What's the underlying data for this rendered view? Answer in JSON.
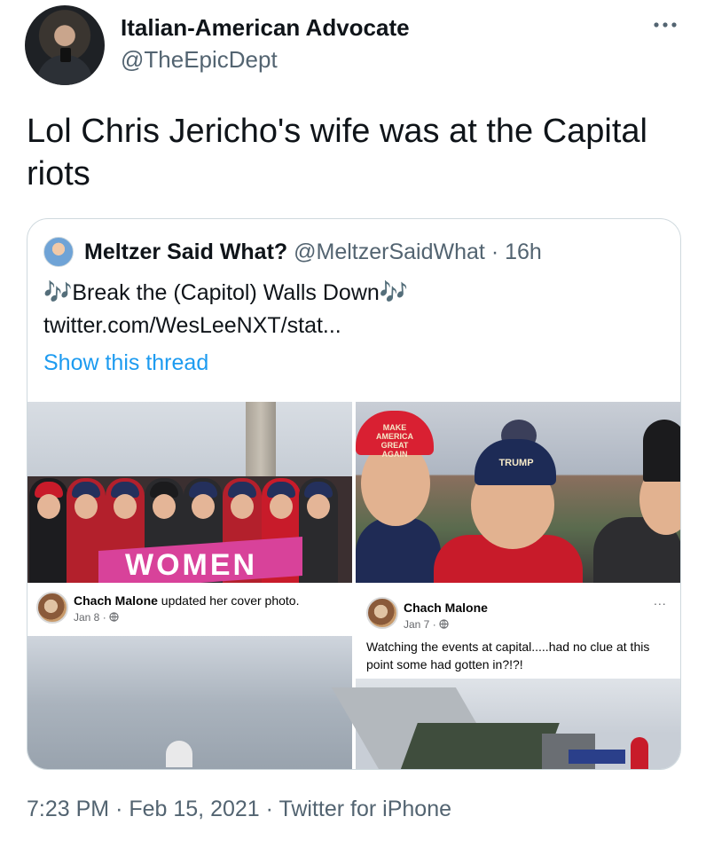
{
  "tweet": {
    "display_name": "Italian-American Advocate",
    "handle": "@TheEpicDept",
    "more_icon": "more-horizontal-icon",
    "text": "Lol Chris Jericho's wife was at the Capital riots"
  },
  "quote": {
    "display_name": "Meltzer Said What?",
    "handle": "@MeltzerSaidWhat",
    "separator": "·",
    "time": "16h",
    "music_icon": "🎶",
    "text": "Break the (Capitol) Walls Down",
    "link": "twitter.com/WesLeeNXT/stat...",
    "show_thread": "Show this thread",
    "media": {
      "banner_text": "WOMEN",
      "hat_text": "MAKE AMERICA GREAT AGAIN",
      "beanie_text": "TRUMP",
      "post_left": {
        "name": "Chach Malone",
        "action": "updated her cover photo.",
        "date": "Jan 8",
        "privacy_icon": "globe-icon"
      },
      "post_right": {
        "name": "Chach Malone",
        "date": "Jan 7",
        "privacy_icon": "globe-icon",
        "text": "Watching the events at capital.....had no clue at this point some had gotten in?!?!",
        "more": "..."
      }
    }
  },
  "footer": {
    "time": "7:23 PM",
    "separator": "·",
    "date": "Feb 15, 2021",
    "source": "Twitter for iPhone"
  },
  "colors": {
    "link": "#1d9bf0",
    "secondary_text": "#536471",
    "border": "#cfd9de"
  }
}
